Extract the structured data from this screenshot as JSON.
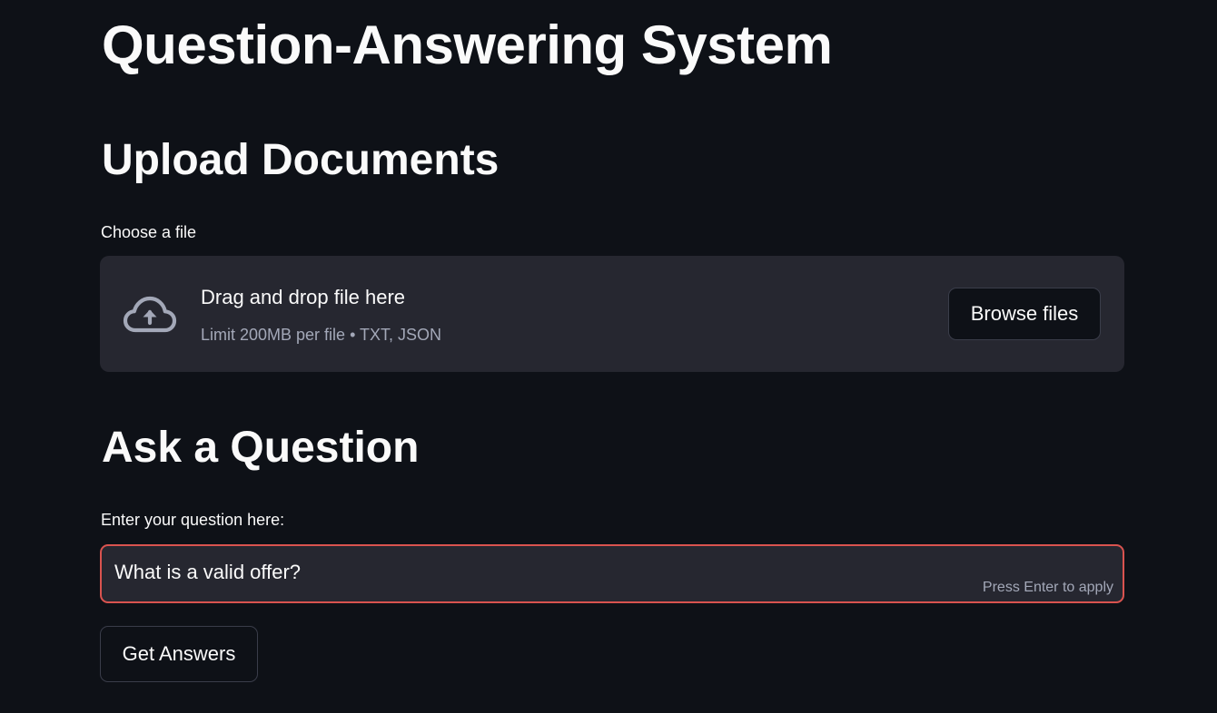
{
  "app": {
    "title": "Question-Answering System"
  },
  "upload": {
    "heading": "Upload Documents",
    "label": "Choose a file",
    "dropzone_text": "Drag and drop file here",
    "dropzone_hint": "Limit 200MB per file • TXT, JSON",
    "icon": "cloud-upload-icon",
    "browse_label": "Browse files"
  },
  "question": {
    "heading": "Ask a Question",
    "label": "Enter your question here:",
    "value": "What is a valid offer?",
    "hint": "Press Enter to apply",
    "submit_label": "Get Answers"
  },
  "colors": {
    "background": "#0e1117",
    "panel": "#262730",
    "text": "#fafafa",
    "muted_text": "#a3a8b8",
    "focus_border": "#ff4b4b"
  }
}
